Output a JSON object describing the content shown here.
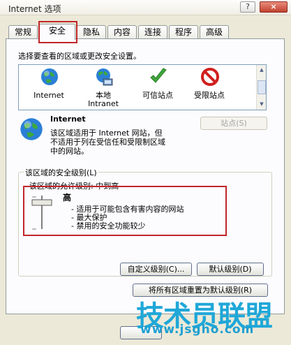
{
  "window": {
    "title": "Internet 选项",
    "help_label": "?",
    "close_label": "×"
  },
  "tabs": [
    "常规",
    "安全",
    "隐私",
    "内容",
    "连接",
    "程序",
    "高级"
  ],
  "active_tab": "安全",
  "security": {
    "prompt": "选择要查看的区域或更改安全设置。",
    "zones": [
      {
        "name": "internet",
        "label": "Internet",
        "icon": "globe-icon"
      },
      {
        "name": "local-intranet",
        "label": "本地\nIntranet",
        "icon": "intranet-globe-icon"
      },
      {
        "name": "trusted-sites",
        "label": "可信站点",
        "icon": "checkmark-icon"
      },
      {
        "name": "restricted-sites",
        "label": "受限站点",
        "icon": "no-entry-icon"
      }
    ],
    "selected_zone": {
      "title": "Internet",
      "description_lines": [
        "该区域适用于 Internet 网站，但",
        "不适用于列在受信任和受限制区域",
        "中的网站。"
      ],
      "sites_button": "站点(S)"
    },
    "level_group": {
      "label": "该区域的安全级别(L)",
      "allowed_levels": "该区域的允许级别: 中到高",
      "level_name": "高",
      "bullets": [
        "- 适用于可能包含有害内容的网站",
        "- 最大保护",
        "- 禁用的安全功能较少"
      ],
      "custom_button": "自定义级别(C)...",
      "default_button": "默认级别(D)"
    },
    "reset_all_button": "将所有区域重置为默认级别(R)"
  },
  "watermark": {
    "text": "技术员联盟",
    "url": "www.jsgho.com"
  },
  "colors": {
    "highlight": "#c0262a",
    "panel": "#fcfcfe",
    "dialog": "#ece9d8",
    "watermark": "#1fa7d8"
  }
}
